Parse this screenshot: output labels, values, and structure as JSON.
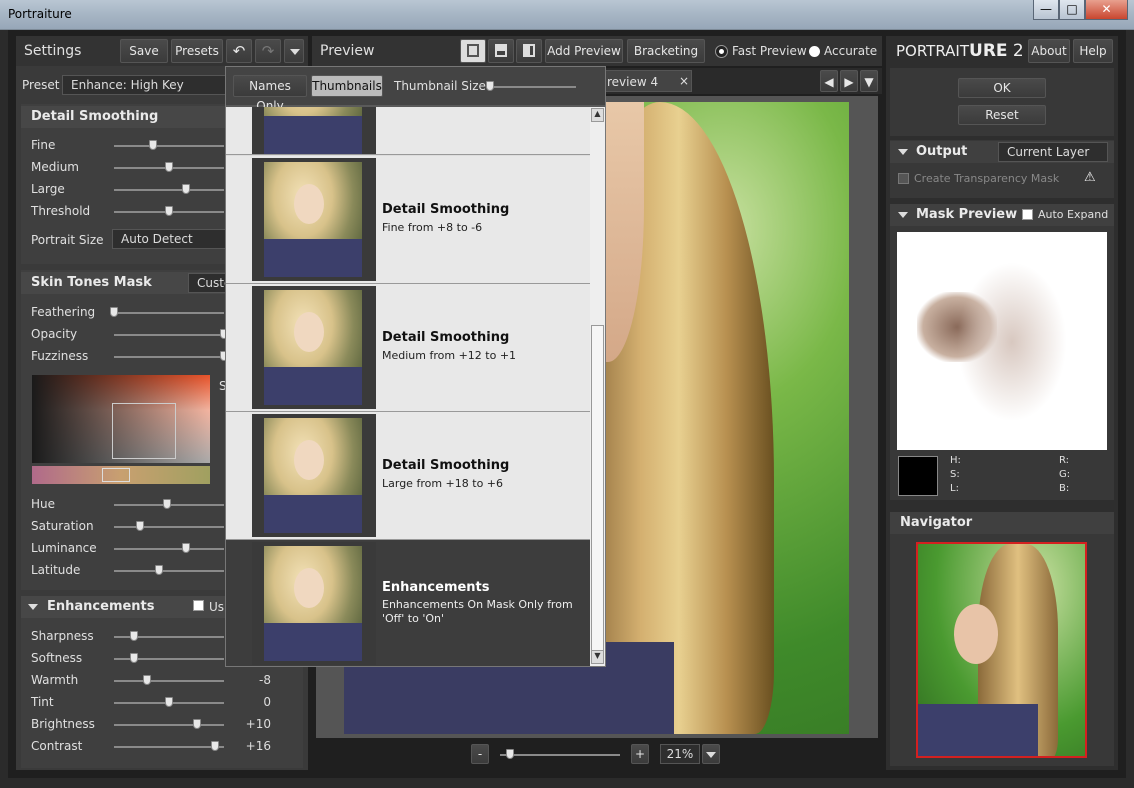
{
  "window": {
    "title": "Portraiture",
    "min": "—",
    "max": "□",
    "close": "✕"
  },
  "settings": {
    "title": "Settings",
    "save": "Save",
    "presets": "Presets",
    "undo": "↶",
    "redo": "↷",
    "preset_label": "Preset",
    "preset_value": "Enhance: High Key"
  },
  "detail": {
    "title": "Detail Smoothing",
    "sliders": [
      {
        "label": "Fine",
        "pos": 0.35
      },
      {
        "label": "Medium",
        "pos": 0.5
      },
      {
        "label": "Large",
        "pos": 0.65
      },
      {
        "label": "Threshold",
        "pos": 0.5
      }
    ],
    "portrait_size_label": "Portrait Size",
    "portrait_size_value": "Auto Detect"
  },
  "skin": {
    "title": "Skin Tones Mask",
    "mode": "Custo",
    "sliders": [
      {
        "label": "Feathering",
        "pos": 0
      },
      {
        "label": "Opacity",
        "pos": 1
      },
      {
        "label": "Fuzziness",
        "pos": 1
      }
    ],
    "swatch_s": "S",
    "hsl": [
      {
        "label": "Hue",
        "pos": 0.48
      },
      {
        "label": "Saturation",
        "pos": 0.24
      },
      {
        "label": "Luminance",
        "pos": 0.65
      },
      {
        "label": "Latitude",
        "pos": 0.41
      }
    ]
  },
  "enh": {
    "title": "Enhancements",
    "use_label": "Us",
    "sliders": [
      {
        "label": "Sharpness",
        "pos": 0.18,
        "value": ""
      },
      {
        "label": "Softness",
        "pos": 0.18,
        "value": ""
      },
      {
        "label": "Warmth",
        "pos": 0.3,
        "value": "-8"
      },
      {
        "label": "Tint",
        "pos": 0.5,
        "value": "0"
      },
      {
        "label": "Brightness",
        "pos": 0.75,
        "value": "+10"
      },
      {
        "label": "Contrast",
        "pos": 0.92,
        "value": "+16"
      }
    ]
  },
  "preview": {
    "title": "Preview",
    "add": "Add Preview",
    "bracketing": "Bracketing",
    "fast": "Fast Preview",
    "accurate": "Accurate",
    "tab": "review 4",
    "tab_close": "×",
    "zoom": "21%",
    "minus": "-",
    "plus": "+"
  },
  "popup": {
    "names_only": "Names Only",
    "thumbnails": "Thumbnails",
    "thumb_size": "Thumbnail Size",
    "items": [
      {
        "title": "Detail Smoothing",
        "sub": "Fine from +8 to -6"
      },
      {
        "title": "Detail Smoothing",
        "sub": "Medium from +12 to +1"
      },
      {
        "title": "Detail Smoothing",
        "sub": "Large from +18 to +6"
      },
      {
        "title": "Enhancements",
        "sub": "Enhancements On Mask Only from",
        "sub2": "'Off' to 'On'"
      }
    ]
  },
  "right": {
    "brand_a": "PORTRAIT",
    "brand_b": "URE",
    "brand_ver": " 2",
    "about": "About",
    "help": "Help",
    "ok": "OK",
    "reset": "Reset",
    "output_title": "Output",
    "output_value": "Current Layer",
    "transparency": "Create Transparency Mask",
    "mask_title": "Mask Preview",
    "auto_expand": "Auto Expand",
    "h": "H:",
    "s": "S:",
    "l": "L:",
    "r": "R:",
    "g": "G:",
    "b": "B:",
    "nav_title": "Navigator"
  }
}
